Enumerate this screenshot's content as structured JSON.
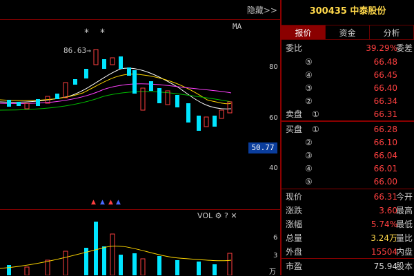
{
  "toolbar": {
    "hide_label": "隐藏>>"
  },
  "chart": {
    "ma_label": "MA",
    "high_marker": "86.63→",
    "stars": [
      "*",
      "*"
    ],
    "y_ticks": [
      "80",
      "60",
      "40"
    ],
    "current_price_tag": "50.77",
    "volume_indicator": "VOL",
    "volume_ticks": [
      "6",
      "3"
    ],
    "volume_unit": "万"
  },
  "quote": {
    "stock_code": "300435",
    "stock_name": "中泰股份",
    "tabs": [
      {
        "label": "报价",
        "active": true
      },
      {
        "label": "资金",
        "active": false
      },
      {
        "label": "分析",
        "active": false
      }
    ],
    "ratio": {
      "label": "委比",
      "value": "39.29%",
      "right_label": "委差"
    },
    "asks": [
      {
        "level": "⑤",
        "price": "66.48"
      },
      {
        "level": "④",
        "price": "66.45"
      },
      {
        "level": "③",
        "price": "66.40"
      },
      {
        "level": "②",
        "price": "66.34"
      },
      {
        "level": "①",
        "label": "卖盘",
        "price": "66.31"
      }
    ],
    "bids": [
      {
        "level": "①",
        "label": "买盘",
        "price": "66.28"
      },
      {
        "level": "②",
        "price": "66.10"
      },
      {
        "level": "③",
        "price": "66.04"
      },
      {
        "level": "④",
        "price": "66.01"
      },
      {
        "level": "⑤",
        "price": "66.00"
      }
    ],
    "stats": [
      {
        "label": "现价",
        "value": "66.31",
        "right": "今开"
      },
      {
        "label": "涨跌",
        "value": "3.60",
        "right": "最高"
      },
      {
        "label": "涨幅",
        "value": "5.74%",
        "right": "最低"
      },
      {
        "label": "总量",
        "value": "3.24",
        "unit": "万",
        "right": "量比"
      },
      {
        "label": "外盘",
        "value": "15504",
        "right": "内盘"
      },
      {
        "label": "市盈",
        "value": "75.94",
        "right": "股本"
      }
    ]
  },
  "colors": {
    "up": "#ff4040",
    "down": "#00e5ff",
    "accent": "#8b0000"
  }
}
